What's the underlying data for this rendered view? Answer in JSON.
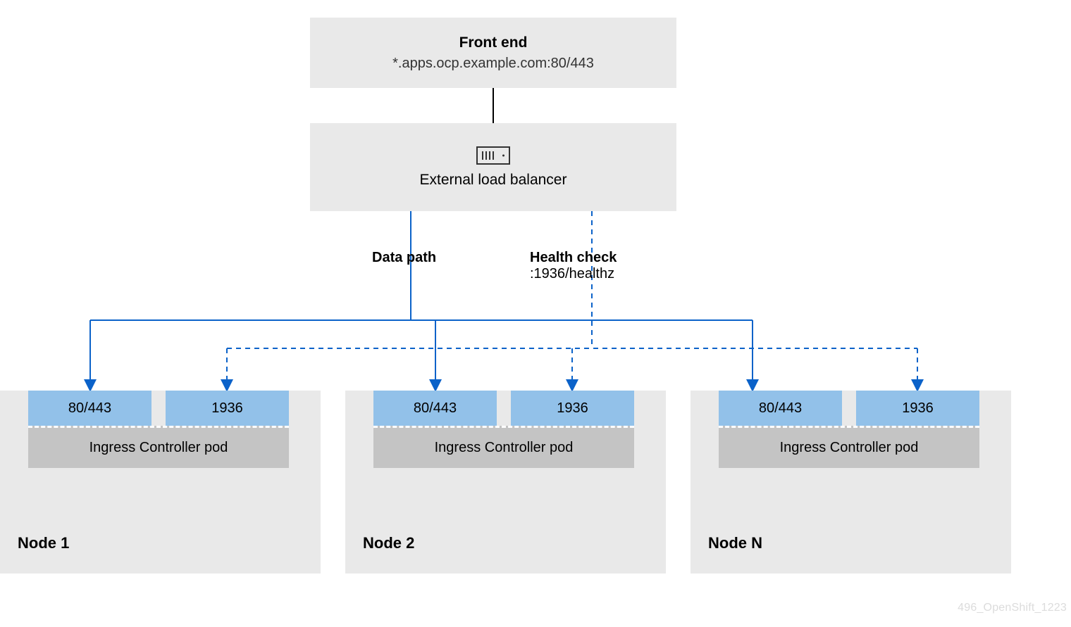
{
  "frontend": {
    "title": "Front end",
    "subtitle": "*.apps.ocp.example.com:80/443"
  },
  "elb": {
    "label": "External load balancer"
  },
  "paths": {
    "data": "Data path",
    "health_label": "Health check",
    "health_value": ":1936/healthz"
  },
  "ports": {
    "data": "80/443",
    "health": "1936"
  },
  "pod_label": "Ingress Controller pod",
  "nodes": {
    "n1": "Node 1",
    "n2": "Node 2",
    "nN": "Node N"
  },
  "watermark": "496_OpenShift_1223",
  "colors": {
    "blue_line": "#0b62c9",
    "port_bg": "#92c1e9",
    "box_bg": "#e9e9e9",
    "pod_bg": "#c4c4c4"
  }
}
